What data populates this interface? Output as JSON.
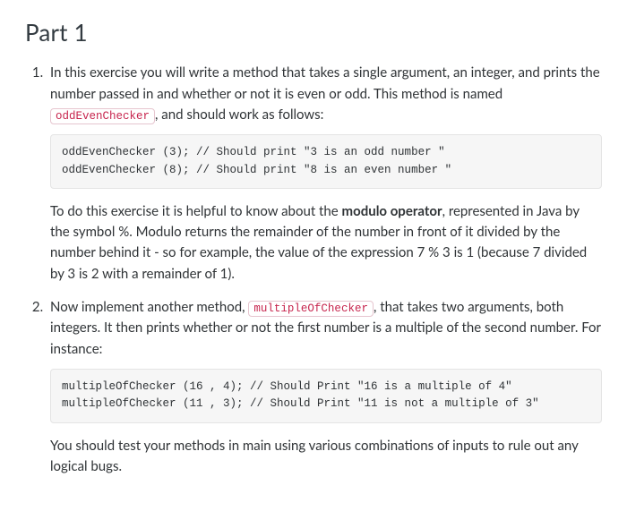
{
  "title": "Part 1",
  "item1": {
    "p1_a": "In this exercise you will write a method that takes a single argument, an integer, and prints the number passed in and whether or not it is even or odd. This method is named ",
    "code1": "oddEvenChecker",
    "p1_b": ", and should work as follows:",
    "codeblock": "oddEvenChecker (3); // Should print \"3 is an odd number \"\noddEvenChecker (8); // Should print \"8 is an even number \"",
    "p2_a": "To do this exercise it is helpful to know about the ",
    "p2_strong": "modulo operator",
    "p2_b": ", represented in Java by the symbol %. Modulo returns the remainder of the number in front of it divided by the number behind it - so for example, the value of the expression 7 % 3 is 1 (because 7 divided by 3 is 2 with a remainder of 1)."
  },
  "item2": {
    "p1_a": "Now implement another method, ",
    "code1": "multipleOfChecker",
    "p1_b": ", that takes two arguments, both integers. It then prints whether or not the first number is a multiple of the second number. For instance:",
    "codeblock": "multipleOfChecker (16 , 4); // Should Print \"16 is a multiple of 4\"\nmultipleOfChecker (11 , 3); // Should Print \"11 is not a multiple of 3\"",
    "p2": "You should test your methods in main using various combinations of inputs to rule out any logical bugs."
  }
}
